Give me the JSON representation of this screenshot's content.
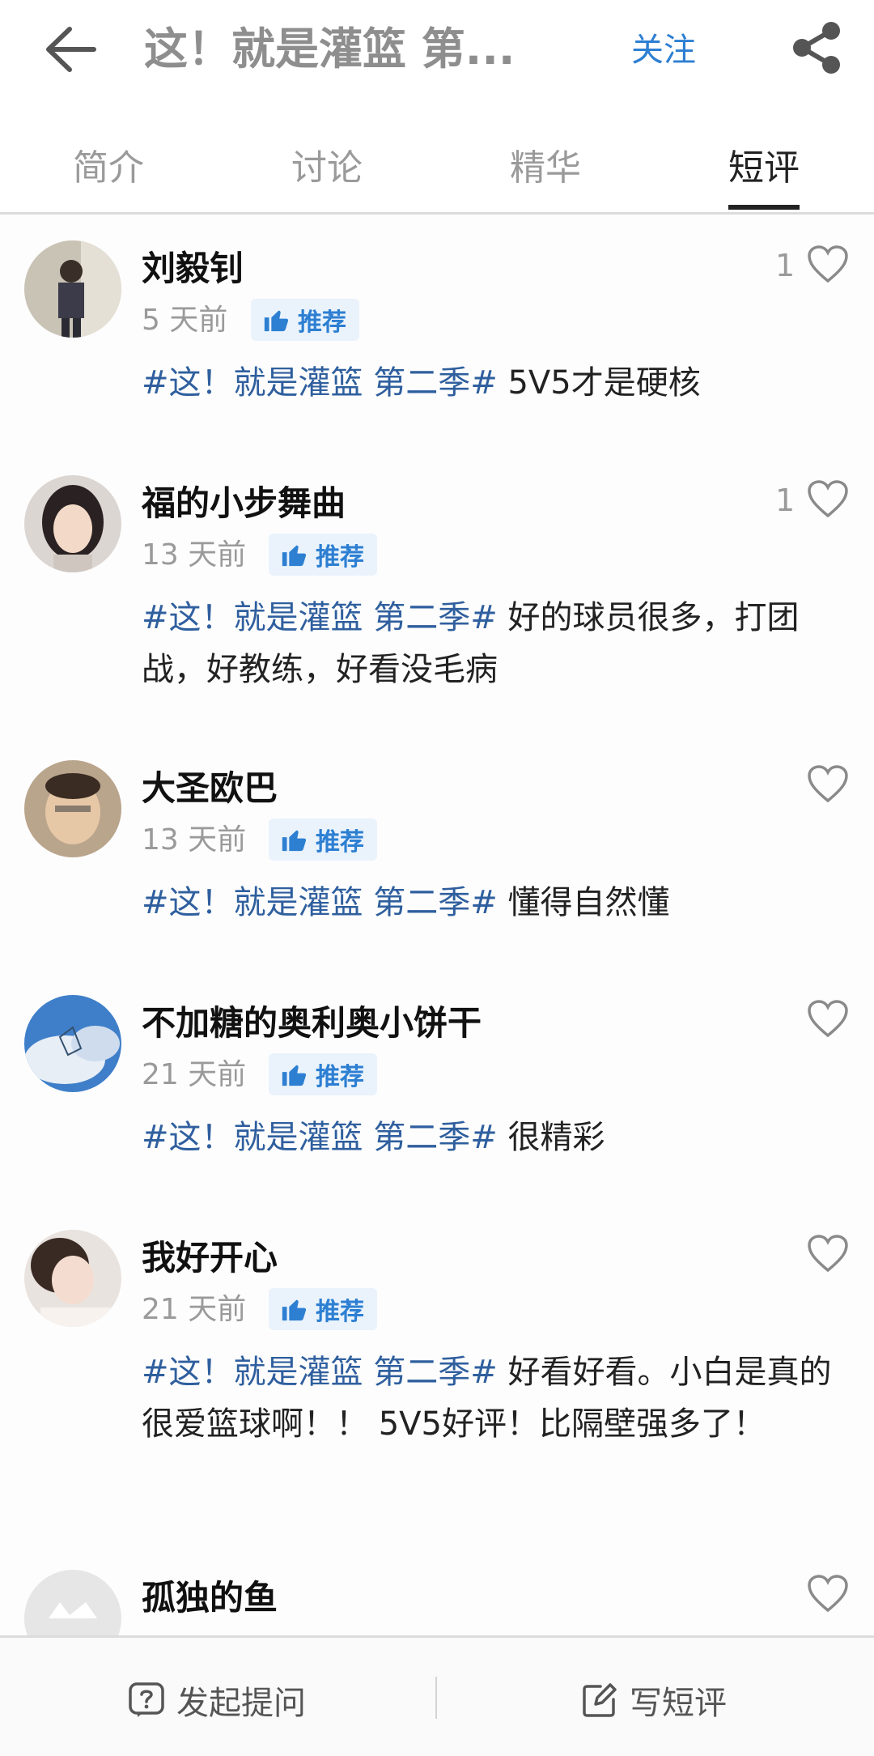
{
  "header": {
    "title": "这！就是灌篮 第...",
    "follow_label": "关注"
  },
  "tabs": [
    {
      "label": "简介"
    },
    {
      "label": "讨论"
    },
    {
      "label": "精华"
    },
    {
      "label": "短评"
    }
  ],
  "active_tab": "短评",
  "recommend_label": "推荐",
  "topic_tag": "#这！就是灌篮 第二季#",
  "reviews": [
    {
      "name": "刘毅钊",
      "time": "5 天前",
      "likes": "1",
      "text": "5V5才是硬核"
    },
    {
      "name": "福的小步舞曲",
      "time": "13 天前",
      "likes": "1",
      "text": "好的球员很多，打团战，好教练，好看没毛病"
    },
    {
      "name": "大圣欧巴",
      "time": "13 天前",
      "likes": "",
      "text": "懂得自然懂"
    },
    {
      "name": "不加糖的奥利奥小饼干",
      "time": "21 天前",
      "likes": "",
      "text": "很精彩"
    },
    {
      "name": "我好开心",
      "time": "21 天前",
      "likes": "",
      "text": "好看好看。小白是真的很爱篮球啊！！ 5V5好评！比隔壁强多了！"
    },
    {
      "name": "孤独的鱼",
      "time": "",
      "likes": "",
      "text": ""
    }
  ],
  "bottom": {
    "ask_label": "发起提问",
    "write_label": "写短评"
  },
  "colors": {
    "accent": "#2d7fd2",
    "tag": "#2f5f9e",
    "muted": "#9a9a9a"
  },
  "icons": [
    "back-arrow-icon",
    "share-icon",
    "thumbs-up-icon",
    "heart-icon",
    "question-icon",
    "edit-icon"
  ]
}
